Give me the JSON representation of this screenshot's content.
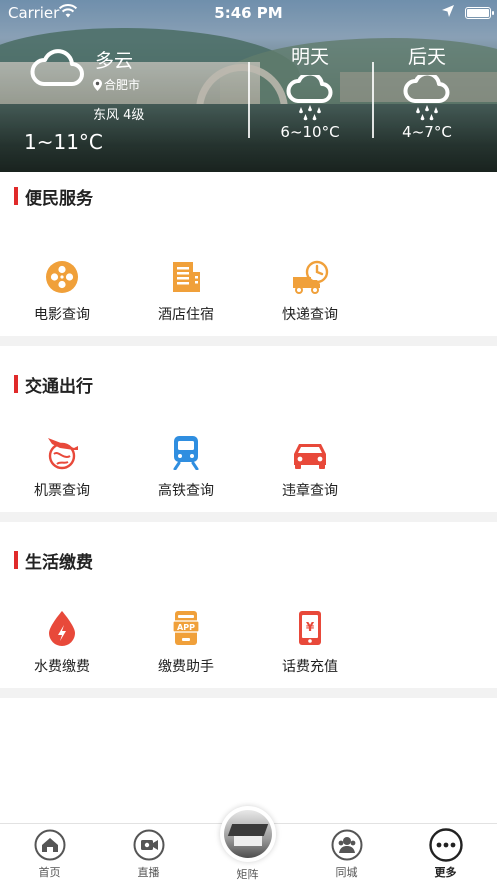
{
  "status_bar": {
    "carrier": "Carrier",
    "time": "5:46 PM"
  },
  "weather": {
    "today": {
      "condition": "多云",
      "city": "合肥市",
      "wind": "东风 4级",
      "temp_range": "1~11°C",
      "icon": "cloud-icon"
    },
    "tomorrow": {
      "label": "明天",
      "temp_range": "6~10°C",
      "icon": "rain-cloud-icon"
    },
    "day_after": {
      "label": "后天",
      "temp_range": "4~7°C",
      "icon": "rain-cloud-icon"
    }
  },
  "sections": {
    "convenience": {
      "title": "便民服务",
      "items": [
        {
          "label": "电影查询",
          "icon": "film-reel-icon",
          "color": "#f0a03a"
        },
        {
          "label": "酒店住宿",
          "icon": "hotel-building-icon",
          "color": "#f0a03a"
        },
        {
          "label": "快递查询",
          "icon": "delivery-truck-icon",
          "color": "#f0a03a"
        }
      ]
    },
    "transport": {
      "title": "交通出行",
      "items": [
        {
          "label": "机票查询",
          "icon": "airplane-icon",
          "color": "#e8493a"
        },
        {
          "label": "高铁查询",
          "icon": "train-icon",
          "color": "#2f8ee0"
        },
        {
          "label": "违章查询",
          "icon": "car-icon",
          "color": "#e8493a"
        }
      ]
    },
    "payments": {
      "title": "生活缴费",
      "items": [
        {
          "label": "水费缴费",
          "icon": "water-drop-icon",
          "color": "#e8493a"
        },
        {
          "label": "缴费助手",
          "icon": "app-phone-icon",
          "color": "#f0a03a"
        },
        {
          "label": "话费充值",
          "icon": "phone-yen-icon",
          "color": "#e8493a"
        }
      ]
    }
  },
  "tabbar": {
    "home": "首页",
    "live": "直播",
    "matrix": "矩阵",
    "local": "同城",
    "more": "更多",
    "active": "more"
  },
  "colors": {
    "accent_red": "#e02a2a",
    "section_gap": "#f2f2f2"
  }
}
